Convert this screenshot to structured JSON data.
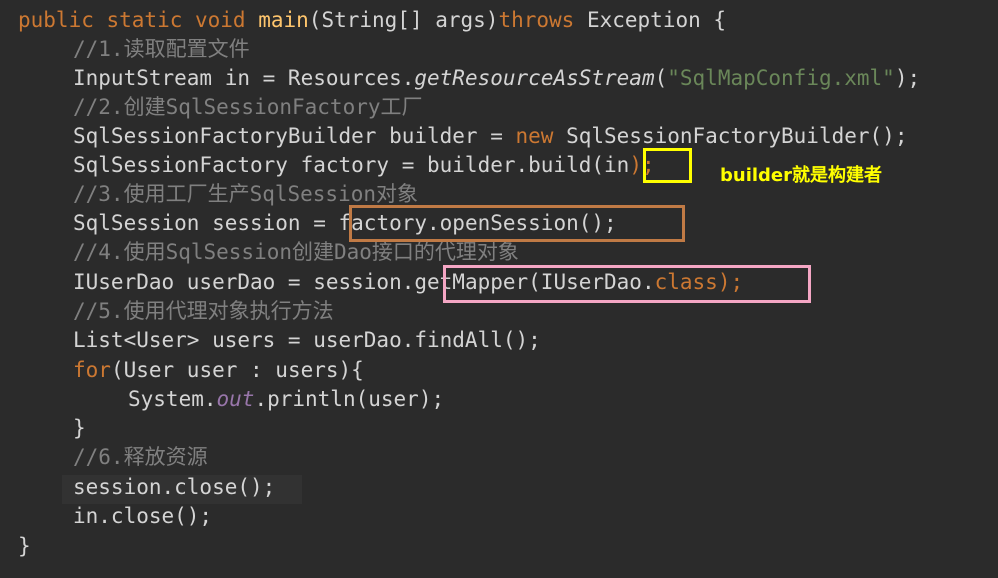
{
  "code": {
    "l1": {
      "a": "public static void ",
      "b": "main",
      "c": "(String[] args)",
      "d": "throws ",
      "e": "Exception {"
    },
    "l2": {
      "a": "//1.读取配置文件"
    },
    "l3": {
      "a": "InputStream in = Resources.",
      "b": "getResourceAsStream",
      "c": "(",
      "d": "\"SqlMapConfig.xml\"",
      "e": ");"
    },
    "l4": {
      "a": "//2.创建SqlSessionFactory工厂"
    },
    "l5": {
      "a": "SqlSessionFactoryBuilder builder = ",
      "b": "new ",
      "c": "SqlSessionFactoryBuilder();"
    },
    "l6": {
      "a": "SqlSessionFactory factory = builder.build(",
      "b": "in",
      "c": ");"
    },
    "l7": {
      "a": "//3.使用工厂生产SqlSession对象"
    },
    "l8": {
      "a": "SqlSession session = ",
      "b": "factory.openSession();"
    },
    "l9": {
      "a": "//4.使用SqlSession创建Dao接口的代理对象"
    },
    "l10": {
      "a": "IUserDao userDao = session.",
      "b": "getMapper(IUserDao.",
      "c": "class",
      "d": ");"
    },
    "l11": {
      "a": "//5.使用代理对象执行方法"
    },
    "l12": {
      "a": "List<User> users = userDao.findAll();"
    },
    "l13": {
      "a": "for",
      "b": "(User user : users){"
    },
    "l14": {
      "a": "System.",
      "b": "out",
      "c": ".println(user);"
    },
    "l15": {
      "a": "}"
    },
    "l16": {
      "a": "//6.释放资源"
    },
    "l17": {
      "a": "session.close();"
    },
    "l18": {
      "a": "in.close();"
    },
    "l19": {
      "a": "}"
    }
  },
  "annotation": {
    "note": "builder就是构建者"
  },
  "colors": {
    "background": "#2b2b2b",
    "keyword": "#cc7832",
    "method": "#ffc66d",
    "comment": "#808080",
    "string": "#6a8759",
    "field": "#9876aa",
    "box_yellow": "#ffff00",
    "box_orange": "#c07a45",
    "box_pink": "#f4a6c4"
  }
}
